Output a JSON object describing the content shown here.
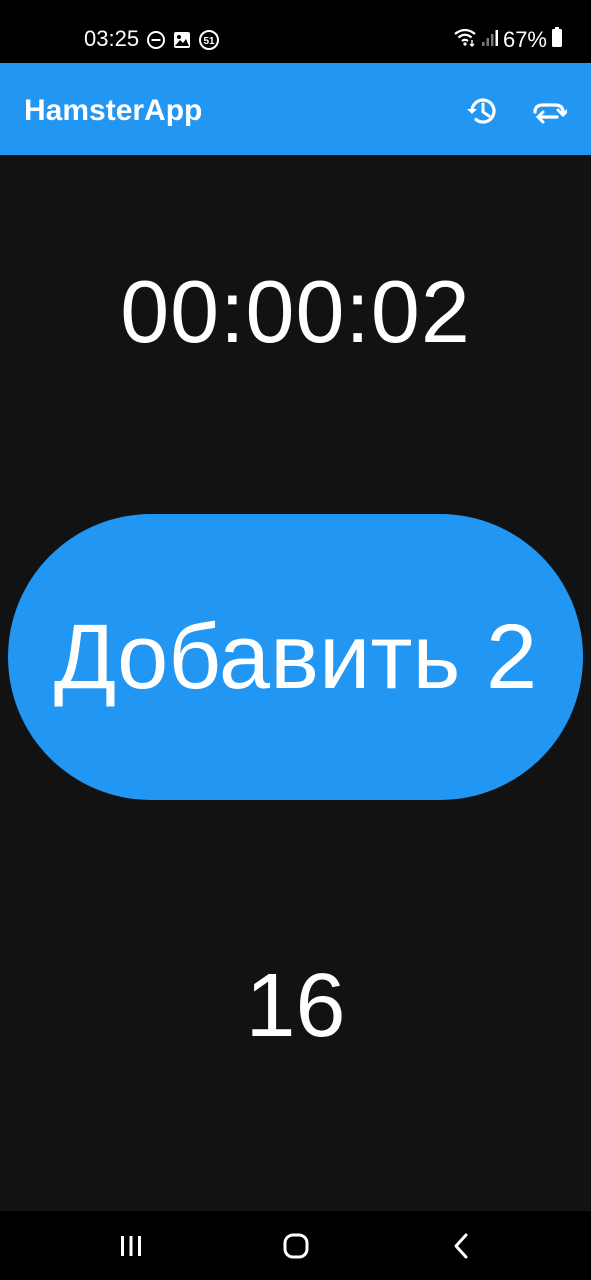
{
  "status_bar": {
    "time": "03:25",
    "battery": "67%",
    "left_icons": [
      "dnd-icon",
      "gallery-icon",
      "badge-51-icon"
    ],
    "badge_count": "51",
    "right_icons": [
      "wifi-icon",
      "signal-icon",
      "battery-icon"
    ]
  },
  "app_bar": {
    "title": "HamsterApp",
    "actions": [
      "history-icon",
      "swap-icon"
    ]
  },
  "timer": {
    "value": "00:00:02"
  },
  "add_button": {
    "label": "Добавить 2"
  },
  "counter": {
    "value": "16"
  },
  "nav_bar": {
    "buttons": [
      "recents-icon",
      "home-icon",
      "back-icon"
    ]
  },
  "colors": {
    "accent": "#2196F3",
    "background": "#121212",
    "text": "#FFFFFF"
  }
}
